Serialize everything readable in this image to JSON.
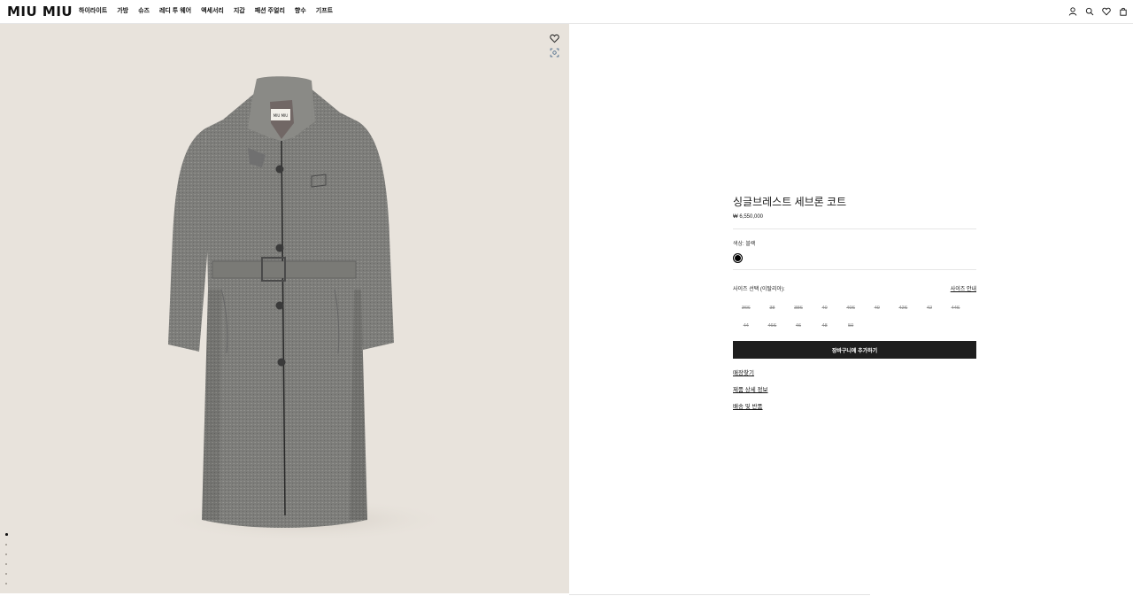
{
  "header": {
    "logo": "MIU MIU",
    "nav": [
      "하이라이트",
      "가방",
      "슈즈",
      "레디 투 웨어",
      "액세서리",
      "지갑",
      "패션 주얼리",
      "향수",
      "기프트"
    ],
    "icons": [
      "account-icon",
      "search-icon",
      "wishlist-icon",
      "bag-icon"
    ]
  },
  "gallery": {
    "label_tag": "MIU MIU",
    "icons": [
      "heart-icon",
      "zoom-icon"
    ],
    "dot_count": 6,
    "active_dot": 0,
    "background": "#e8e3dc"
  },
  "product": {
    "title": "싱글브레스트 세브론 코트",
    "price": "₩ 6,550,000",
    "color_label": "색상:",
    "color_value": "블랙",
    "swatch_color": "#000000",
    "size_label": "사이즈 선택 (이탈리아):",
    "size_guide": "사이즈 안내",
    "sizes": [
      "36S",
      "38",
      "38S",
      "40",
      "40S",
      "40",
      "42S",
      "42",
      "44S",
      "44",
      "46S",
      "46",
      "48",
      "50"
    ],
    "add_to_cart": "장바구니에 추가하기",
    "links": [
      "매장찾기",
      "제품 상세 정보",
      "배송 및 반품"
    ]
  },
  "colors": {
    "button_bg": "#1e1e1e",
    "text": "#1a1a1a",
    "disabled_size": "#8c8c8c"
  }
}
